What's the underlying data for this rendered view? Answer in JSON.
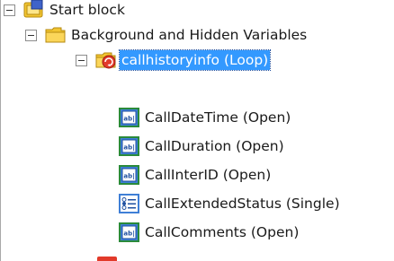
{
  "tree": {
    "items": [
      {
        "label": "Start block",
        "icon": "start-block-icon",
        "expanded": true,
        "selected": false
      },
      {
        "label": "Background and Hidden Variables",
        "icon": "folder-icon",
        "expanded": true,
        "selected": false
      },
      {
        "label": "callhistoryinfo (Loop)",
        "icon": "loop-folder-icon",
        "expanded": true,
        "selected": true
      },
      {
        "label": "CallDateTime (Open)",
        "icon": "open-question-icon",
        "selected": false
      },
      {
        "label": "CallDuration (Open)",
        "icon": "open-question-icon",
        "selected": false
      },
      {
        "label": "CallInterID (Open)",
        "icon": "open-question-icon",
        "selected": false
      },
      {
        "label": "CallExtendedStatus (Single)",
        "icon": "single-question-icon",
        "selected": false
      },
      {
        "label": "CallComments (Open)",
        "icon": "open-question-icon",
        "selected": false
      }
    ]
  },
  "colors": {
    "selection": "#3399ff",
    "open_icon_border": "#2a8a3a",
    "open_icon_inner": "#3f7fd6",
    "folder_yellow": "#f2c531",
    "loop_badge": "#e23a2a"
  }
}
